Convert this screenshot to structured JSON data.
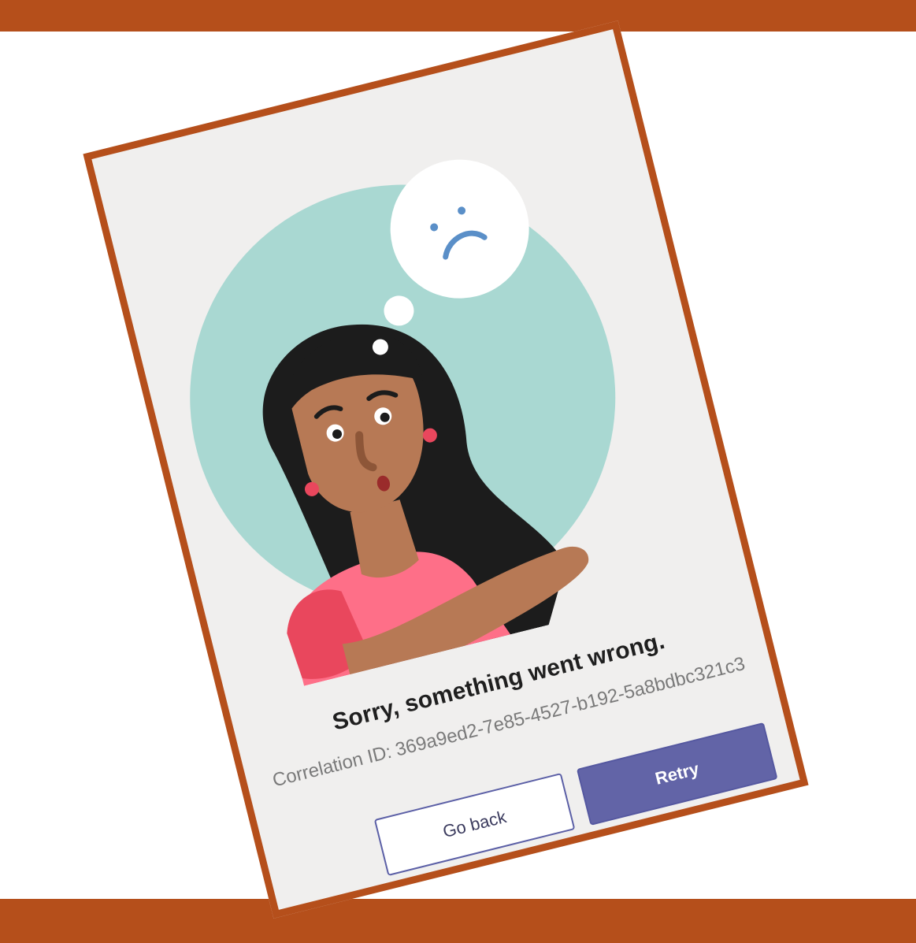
{
  "dialog": {
    "title": "Sorry, something went wrong.",
    "correlation_label": "Correlation ID:",
    "correlation_id": "369a9ed2-7e85-4527-b192-5a8bdbc321c3"
  },
  "actions": {
    "go_back_label": "Go back",
    "retry_label": "Retry"
  },
  "colors": {
    "frame": "#b54f1b",
    "card_background": "#f0efee",
    "circle": "#a9d8d2",
    "primary_button": "#6264a7",
    "shirt": "#fe6f88",
    "sleeve": "#e9475d",
    "hair": "#1c1c1c",
    "skin": "#b77955"
  },
  "illustration": {
    "name": "sad-person-thought-bubble",
    "thought_icon": "sad-face-icon"
  }
}
